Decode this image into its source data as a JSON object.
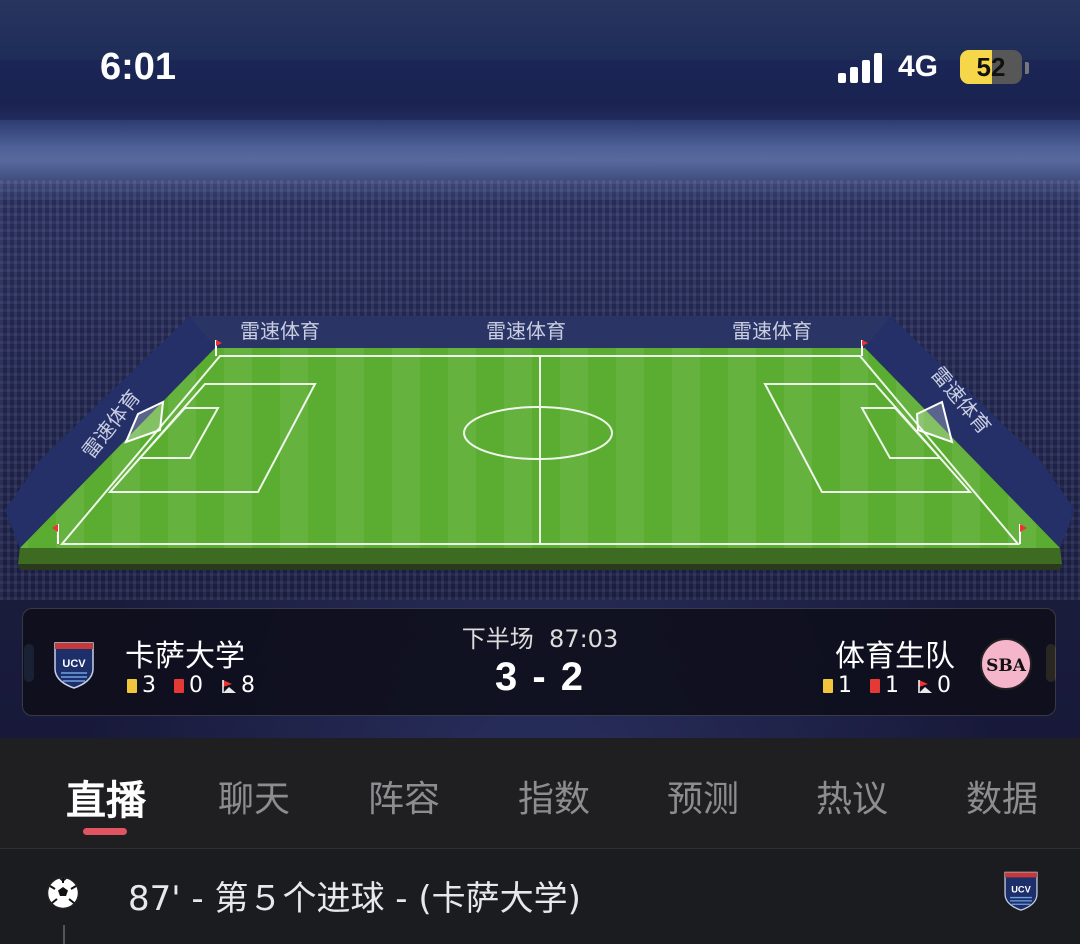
{
  "status_bar": {
    "time": "6:01",
    "network": "4G",
    "battery": "52",
    "battery_level": 0.52,
    "signal_bars": 4
  },
  "stadium": {
    "board_text": "雷速体育",
    "pitch_colors": {
      "grass_light": "#6bbf3a",
      "grass_dark": "#4f9b2b",
      "edge": "#2a4a1a"
    }
  },
  "match": {
    "period": "下半场",
    "clock": "87:03",
    "score": "3 - 2",
    "home": {
      "name": "卡萨大学",
      "crest": "UCV",
      "color": "#6fb6f0",
      "yellow_cards": "3",
      "red_cards": "0",
      "corners": "8"
    },
    "away": {
      "name": "体育生队",
      "crest": "SBA",
      "color": "#f2d55a",
      "yellow_cards": "1",
      "red_cards": "1",
      "corners": "0"
    }
  },
  "tabs": [
    "直播",
    "聊天",
    "阵容",
    "指数",
    "预测",
    "热议",
    "数据"
  ],
  "active_tab": 0,
  "events": [
    {
      "text": "87' - 第５个进球 - (卡萨大学)",
      "icon": "soccer-ball-icon",
      "team_crest": "UCV"
    }
  ],
  "colors": {
    "accent": "#e05561",
    "background": "#1b1c20"
  }
}
